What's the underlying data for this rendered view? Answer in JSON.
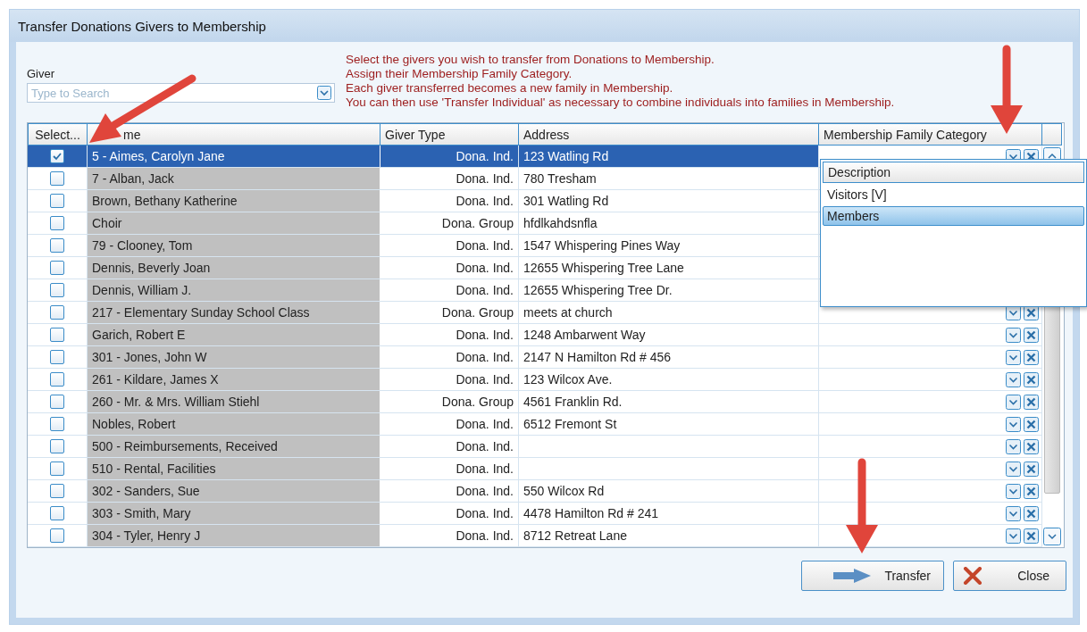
{
  "window": {
    "title": "Transfer Donations Givers to Membership"
  },
  "giver": {
    "label": "Giver",
    "placeholder": "Type to Search"
  },
  "instructions": [
    "Select the givers you wish to transfer from Donations to Membership.",
    "Assign their Membership Family Category.",
    "Each giver transferred becomes a new family in Membership.",
    "You can then use 'Transfer Individual' as necessary to combine individuals into families in Membership."
  ],
  "table": {
    "columns": [
      "Select...",
      "me",
      "Giver Type",
      "Address",
      "Membership Family Category"
    ],
    "rows": [
      {
        "selected": true,
        "checked": true,
        "name": "5 - Aimes, Carolyn Jane",
        "type": "Dona. Ind.",
        "address": "123 Watling Rd"
      },
      {
        "selected": false,
        "checked": false,
        "name": "7 - Alban, Jack",
        "type": "Dona. Ind.",
        "address": "780 Tresham"
      },
      {
        "selected": false,
        "checked": false,
        "name": "Brown, Bethany Katherine",
        "type": "Dona. Ind.",
        "address": "301 Watling Rd"
      },
      {
        "selected": false,
        "checked": false,
        "name": "Choir",
        "type": "Dona. Group",
        "address": "hfdlkahdsnfla"
      },
      {
        "selected": false,
        "checked": false,
        "name": "79 - Clooney, Tom",
        "type": "Dona. Ind.",
        "address": "1547 Whispering Pines Way"
      },
      {
        "selected": false,
        "checked": false,
        "name": "Dennis, Beverly Joan",
        "type": "Dona. Ind.",
        "address": "12655 Whispering Tree Lane"
      },
      {
        "selected": false,
        "checked": false,
        "name": "Dennis, William J.",
        "type": "Dona. Ind.",
        "address": "12655 Whispering Tree Dr."
      },
      {
        "selected": false,
        "checked": false,
        "name": "217 - Elementary Sunday School Class",
        "type": "Dona. Group",
        "address": "meets at church"
      },
      {
        "selected": false,
        "checked": false,
        "name": "Garich, Robert E",
        "type": "Dona. Ind.",
        "address": "1248 Ambarwent Way"
      },
      {
        "selected": false,
        "checked": false,
        "name": "301 - Jones, John W",
        "type": "Dona. Ind.",
        "address": "2147 N Hamilton Rd # 456"
      },
      {
        "selected": false,
        "checked": false,
        "name": "261 - Kildare, James X",
        "type": "Dona. Ind.",
        "address": "123 Wilcox Ave."
      },
      {
        "selected": false,
        "checked": false,
        "name": "260 - Mr. & Mrs. William Stiehl",
        "type": "Dona. Group",
        "address": "4561 Franklin Rd."
      },
      {
        "selected": false,
        "checked": false,
        "name": "Nobles, Robert",
        "type": "Dona. Ind.",
        "address": "6512 Fremont St"
      },
      {
        "selected": false,
        "checked": false,
        "name": "500 - Reimbursements, Received",
        "type": "Dona. Ind."
      },
      {
        "selected": false,
        "checked": false,
        "name": "510 - Rental, Facilities",
        "type": "Dona. Ind."
      },
      {
        "selected": false,
        "checked": false,
        "name": "302 - Sanders, Sue",
        "type": "Dona. Ind.",
        "address": "550 Wilcox Rd"
      },
      {
        "selected": false,
        "checked": false,
        "name": "303 - Smith, Mary",
        "type": "Dona. Ind.",
        "address": "4478 Hamilton Rd # 241"
      },
      {
        "selected": false,
        "checked": false,
        "name": "304 - Tyler, Henry J",
        "type": "Dona. Ind.",
        "address": "8712 Retreat Lane"
      }
    ]
  },
  "category_dropdown": {
    "header": "Description",
    "options": [
      {
        "label": "Visitors [V]",
        "selected": false
      },
      {
        "label": "Members",
        "selected": true
      }
    ]
  },
  "buttons": [
    {
      "label": "Transfer",
      "kind": "transfer"
    },
    {
      "label": "Close",
      "kind": "close"
    }
  ]
}
